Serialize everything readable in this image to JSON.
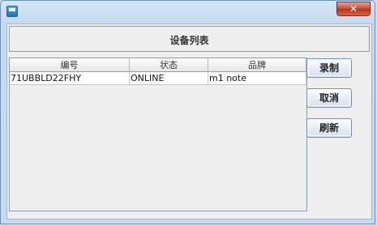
{
  "window": {
    "close_symbol": "✕"
  },
  "header": {
    "title": "设备列表"
  },
  "table": {
    "columns": [
      "编号",
      "状态",
      "品牌"
    ],
    "rows": [
      [
        "71UBBLD22FHY",
        "ONLINE",
        "m1 note"
      ]
    ]
  },
  "buttons": {
    "record": "录制",
    "cancel": "取消",
    "refresh": "刷新"
  },
  "icons": {
    "app": "app-window-icon",
    "close": "close-icon"
  }
}
